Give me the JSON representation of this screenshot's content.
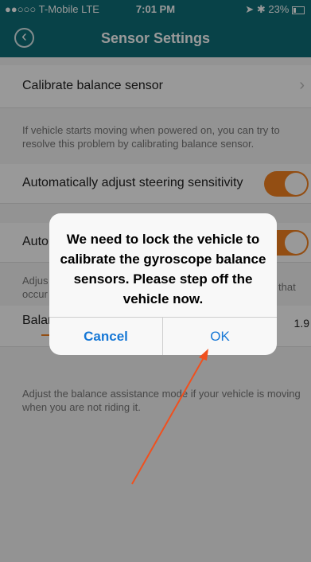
{
  "status": {
    "carrier": "●●○○○ T-Mobile  LTE",
    "time": "7:01 PM",
    "battery": "23%"
  },
  "nav": {
    "title": "Sensor Settings"
  },
  "settings": {
    "calibrate_label": "Calibrate balance sensor",
    "calibrate_desc": "If vehicle starts moving when powered on, you can try to resolve this problem by calibrating balance sensor.",
    "auto_steering_label": "Automatically adjust steering sensitivity",
    "auto_steering_on": true,
    "second_toggle_label_partial": "Auto",
    "second_toggle_on": true,
    "partial_desc_left": "Adjus\noccur",
    "partial_desc_right": "that",
    "balance_label_partial": "Balar",
    "balance_value": "1.9",
    "balance_assist_desc": "Adjust the balance assistance mode if your vehicle is moving when you are not riding it."
  },
  "dialog": {
    "message": "We need to lock the vehicle to calibrate the gyroscope balance sensors. Please step off the vehicle now.",
    "cancel_label": "Cancel",
    "ok_label": "OK"
  },
  "colors": {
    "nav": "#0e6f78",
    "accent": "#f58220",
    "link": "#1778d6",
    "annotation_arrow": "#f0501e"
  }
}
